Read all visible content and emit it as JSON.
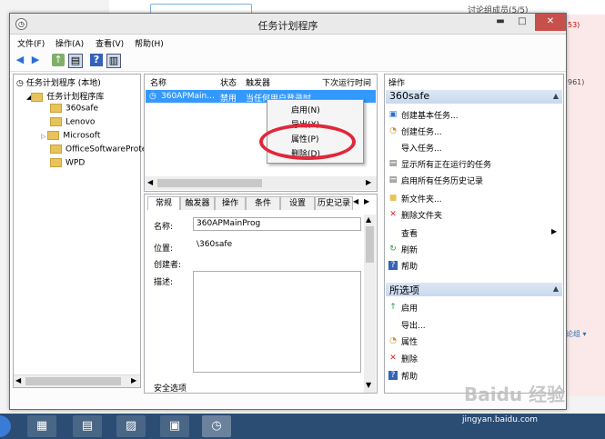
{
  "background": {
    "discuss": "讨论组成员(5/5)",
    "num1": "53)",
    "num2": "961)",
    "discuss2": "论组 ▾"
  },
  "window": {
    "title": "任务计划程序",
    "minimize": "▬",
    "maximize": "□",
    "close": "✕"
  },
  "menu": [
    "文件(F)",
    "操作(A)",
    "查看(V)",
    "帮助(H)"
  ],
  "tree": {
    "root": "任务计划程序 (本地)",
    "library": "任务计划程序库",
    "folders": [
      "360safe",
      "Lenovo",
      "Microsoft",
      "OfficeSoftwareProte",
      "WPD"
    ]
  },
  "task_list": {
    "columns": [
      "名称",
      "状态",
      "触发器",
      "下次运行时间"
    ],
    "row": {
      "name": "360APMain...",
      "status": "禁用",
      "trigger": "当任何用户登录时"
    }
  },
  "context_menu": [
    "启用(N)",
    "导出(X)...",
    "属性(P)",
    "删除(D)"
  ],
  "detail": {
    "tabs": [
      "常规",
      "触发器",
      "操作",
      "条件",
      "设置",
      "历史记录"
    ],
    "name_label": "名称:",
    "name_value": "360APMainProg",
    "location_label": "位置:",
    "location_value": "\\360safe",
    "author_label": "创建者:",
    "desc_label": "描述:",
    "security_label": "安全选项"
  },
  "actions": {
    "header": "操作",
    "section1": "360safe",
    "items1": [
      "创建基本任务...",
      "创建任务...",
      "导入任务...",
      "显示所有正在运行的任务",
      "启用所有任务历史记录",
      "新文件夹...",
      "删除文件夹",
      "查看",
      "刷新",
      "帮助"
    ],
    "section2": "所选项",
    "items2": [
      "启用",
      "导出...",
      "属性",
      "删除",
      "帮助"
    ]
  },
  "taskbar": {
    "tray": "jingyan.baidu.com",
    "watermark": "Baidu 经验"
  }
}
